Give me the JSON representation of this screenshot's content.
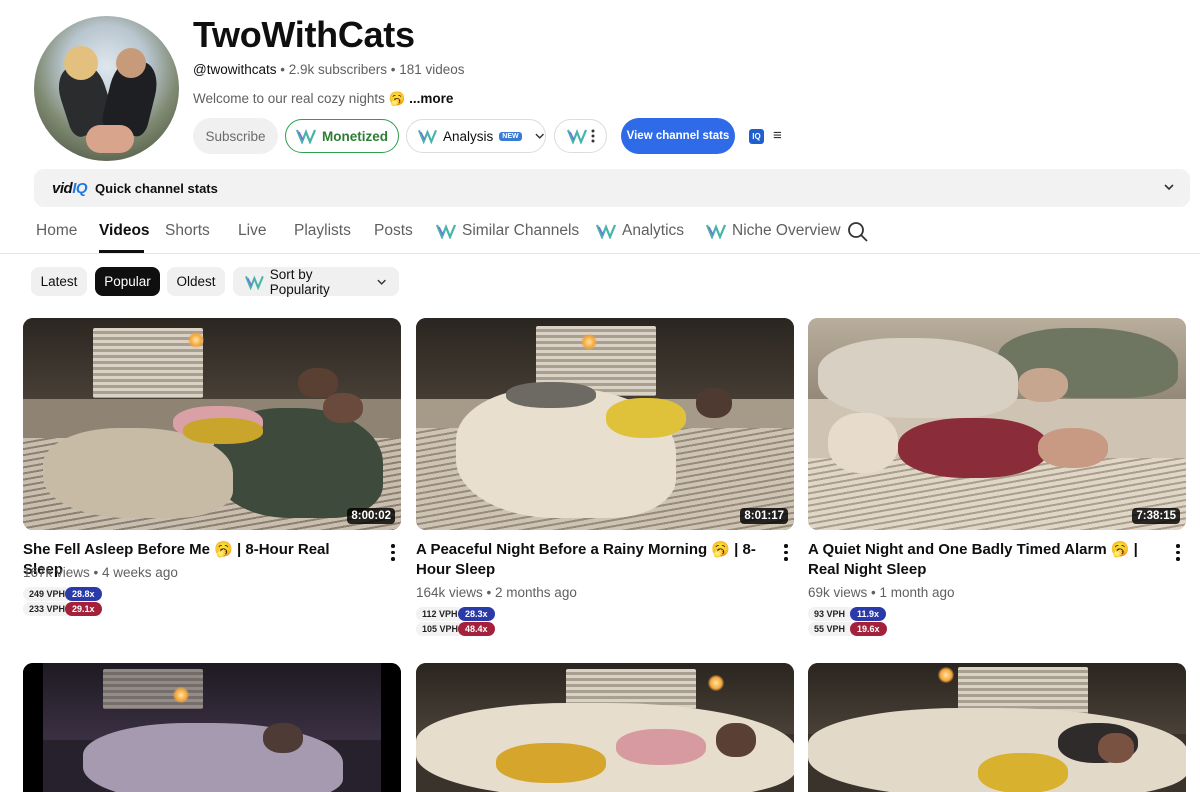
{
  "channel": {
    "name": "TwoWithCats",
    "handle": "@twowithcats",
    "subscribers": "2.9k subscribers",
    "videos": "181 videos",
    "separator": " • ",
    "description": "Welcome to our real cozy nights 🥱",
    "more": " ...more"
  },
  "actions": {
    "subscribe": "Subscribe",
    "monetized": "Monetized",
    "analysis": "Analysis",
    "analysis_badge": "NEW",
    "view_stats": "View channel stats",
    "iq": "IQ"
  },
  "quick_stats": {
    "logo_main": "vid",
    "logo_accent": "IQ",
    "label": "Quick channel stats"
  },
  "tabs": [
    {
      "label": "Home"
    },
    {
      "label": "Videos"
    },
    {
      "label": "Shorts"
    },
    {
      "label": "Live"
    },
    {
      "label": "Playlists"
    },
    {
      "label": "Posts"
    },
    {
      "label": "Similar Channels"
    },
    {
      "label": "Analytics"
    },
    {
      "label": "Niche Overview"
    }
  ],
  "active_tab": "Videos",
  "filters": {
    "latest": "Latest",
    "popular": "Popular",
    "oldest": "Oldest",
    "sort": "Sort by Popularity",
    "active": "Popular"
  },
  "videos": [
    {
      "title": "She Fell Asleep Before Me 🥱 | 8-Hour Real Sleep",
      "duration": "8:00:02",
      "views": "167k views",
      "age": "4 weeks ago",
      "vph1": "249 VPH",
      "mult1": "28.8x",
      "vph2": "233 VPH",
      "mult2": "29.1x"
    },
    {
      "title": "A Peaceful Night Before a Rainy Morning 🥱 | 8-Hour Sleep",
      "duration": "8:01:17",
      "views": "164k views",
      "age": "2 months ago",
      "vph1": "112 VPH",
      "mult1": "28.3x",
      "vph2": "105 VPH",
      "mult2": "48.4x"
    },
    {
      "title": "A Quiet Night and One Badly Timed Alarm 🥱 | Real Night Sleep",
      "duration": "7:38:15",
      "views": "69k views",
      "age": "1 month ago",
      "vph1": "93 VPH",
      "mult1": "11.9x",
      "vph2": "55 VPH",
      "mult2": "19.6x"
    }
  ],
  "colors": {
    "accent_blue": "#2f6be8",
    "monetized_green": "#2e9f50",
    "mult_blue": "#2a3aa8",
    "mult_red": "#a3213a"
  },
  "icons": [
    "vidiq-logo-icon",
    "chevron-down-icon",
    "more-vert-icon",
    "menu-icon",
    "search-icon",
    "iq-icon"
  ]
}
